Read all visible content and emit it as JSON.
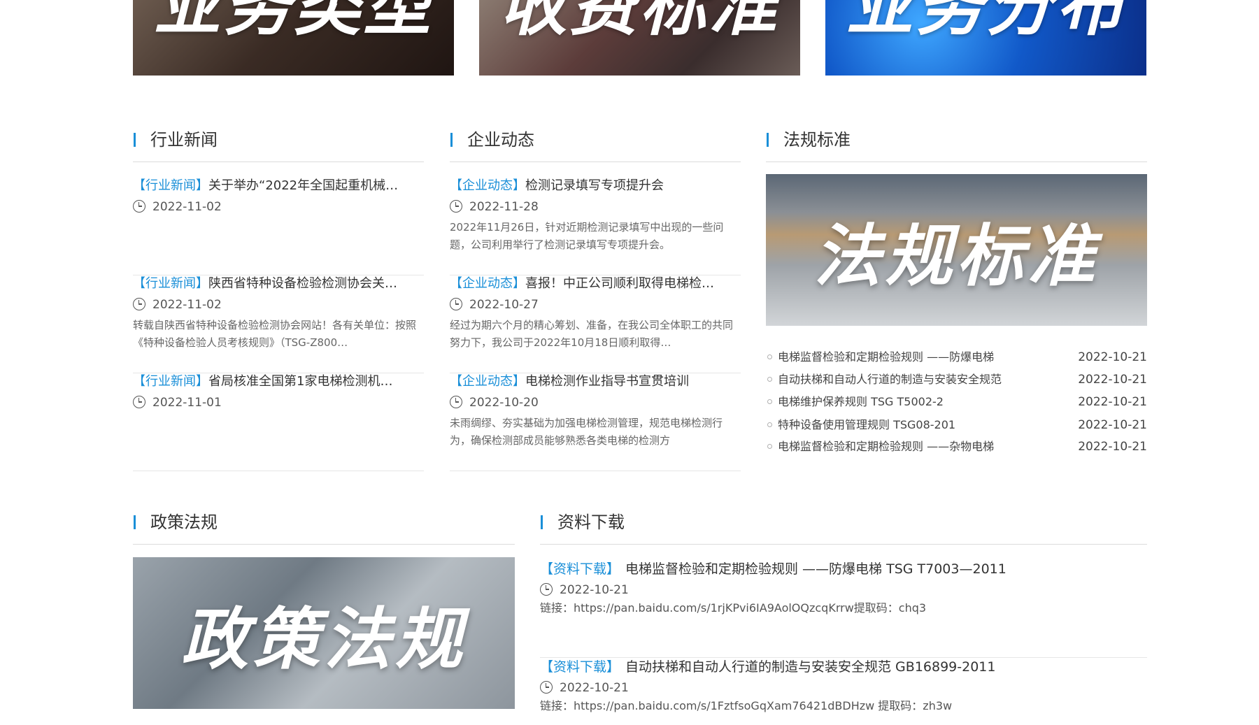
{
  "banners": [
    {
      "text": "业务类型"
    },
    {
      "text": "收费标准"
    },
    {
      "text": "业务分布"
    }
  ],
  "industry_news": {
    "title": "行业新闻",
    "items": [
      {
        "tag": "【行业新闻】",
        "title": "关于举办“2022年全国起重机械…",
        "date": "2022-11-02",
        "summary": ""
      },
      {
        "tag": "【行业新闻】",
        "title": "陕西省特种设备检验检测协会关…",
        "date": "2022-11-02",
        "summary": "转载自陕西省特种设备检验检测协会网站！各有关单位：按照《特种设备检验人员考核规则》（TSG-Z800…"
      },
      {
        "tag": "【行业新闻】",
        "title": "省局核准全国第1家电梯检测机…",
        "date": "2022-11-01",
        "summary": ""
      }
    ]
  },
  "company_news": {
    "title": "企业动态",
    "items": [
      {
        "tag": "【企业动态】",
        "title": "检测记录填写专项提升会",
        "date": "2022-11-28",
        "summary": "2022年11月26日，针对近期检测记录填写中出现的一些问题，公司利用举行了检测记录填写专项提升会。"
      },
      {
        "tag": "【企业动态】",
        "title": "喜报！中正公司顺利取得电梯检…",
        "date": "2022-10-27",
        "summary": "经过为期六个月的精心筹划、准备，在我公司全体职工的共同努力下，我公司于2022年10月18日顺利取得…"
      },
      {
        "tag": "【企业动态】",
        "title": "电梯检测作业指导书宣贯培训",
        "date": "2022-10-20",
        "summary": "未雨绸缪、夯实基础为加强电梯检测管理，规范电梯检测行为，确保检测部成员能够熟悉各类电梯的检测方"
      }
    ]
  },
  "regulations": {
    "title": "法规标准",
    "image_text": "法规标准",
    "items": [
      {
        "title": "电梯监督检验和定期检验规则 ——防爆电梯",
        "date": "2022-10-21"
      },
      {
        "title": "自动扶梯和自动人行道的制造与安装安全规范",
        "date": "2022-10-21"
      },
      {
        "title": "电梯维护保养规则 TSG T5002-2",
        "date": "2022-10-21"
      },
      {
        "title": "特种设备使用管理规则 TSG08-201",
        "date": "2022-10-21"
      },
      {
        "title": "电梯监督检验和定期检验规则 ——杂物电梯",
        "date": "2022-10-21"
      }
    ]
  },
  "policy": {
    "title": "政策法规",
    "image_text": "政策法规"
  },
  "downloads": {
    "title": "资料下载",
    "items": [
      {
        "tag": "【资料下载】",
        "title": "电梯监督检验和定期检验规则 ——防爆电梯 TSG T7003—2011",
        "date": "2022-10-21",
        "link": "链接：https://pan.baidu.com/s/1rjKPvi6IA9AolOQzcqKrrw提取码：chq3"
      },
      {
        "tag": "【资料下载】",
        "title": "自动扶梯和自动人行道的制造与安装安全规范 GB16899-2011",
        "date": "2022-10-21",
        "link": "链接：https://pan.baidu.com/s/1FztfsoGqXam76421dBDHzw 提取码：zh3w"
      }
    ]
  },
  "colors": {
    "accent": "#1a8fd8",
    "text": "#333333",
    "divider": "#dcdcdc"
  },
  "icons": {
    "date": "clock-icon",
    "list_bullet": "circle-bullet-icon"
  }
}
